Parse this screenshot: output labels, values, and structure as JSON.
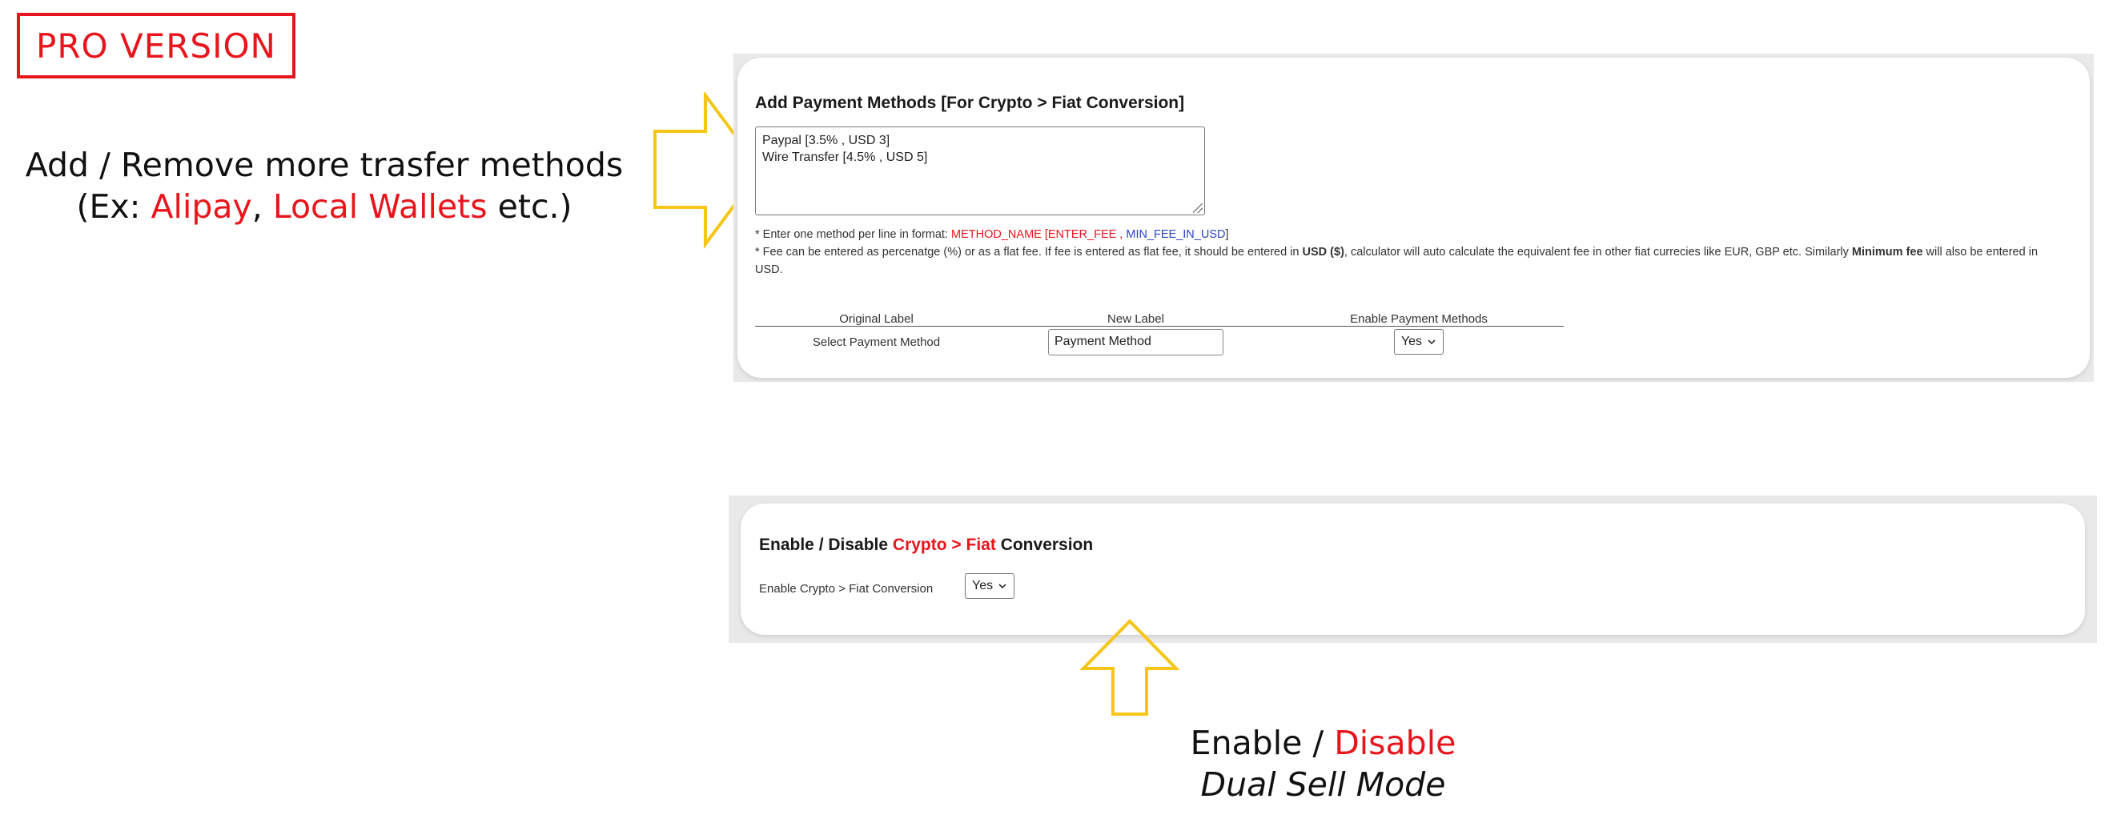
{
  "badge": {
    "label": "PRO VERSION"
  },
  "note_left": {
    "line1": "Add / Remove more trasfer methods",
    "line2_open": "(Ex: ",
    "line2_alipay": "Alipay",
    "line2_comma": ", ",
    "line2_local": "Local Wallets",
    "line2_close": " etc.)"
  },
  "payment_panel": {
    "title": "Add Payment Methods [For Crypto > Fiat Conversion]",
    "methods": [
      "Paypal [3.5% , USD 3]",
      "Wire Transfer [4.5% , USD 5]"
    ],
    "hint1_prefix": "* Enter one method per line in format: ",
    "hint1_method": "METHOD_NAME [ENTER_FEE ,",
    "hint1_min": "MIN_FEE_IN_USD",
    "hint1_close": "]",
    "hint2_a": "* Fee can be entered as percenatge (%) or as a flat fee. If fee is entered as flat fee, it should be entered in ",
    "hint2_usd": "USD ($)",
    "hint2_b": ", calculator will auto calculate the equivalent fee in other fiat currecies like EUR, GBP etc. Similarly ",
    "hint2_min": "Minimum fee",
    "hint2_c": " will also be entered in USD.",
    "table": {
      "headers": [
        "Original Label",
        "New Label",
        "Enable Payment Methods"
      ],
      "row": {
        "original": "Select Payment Method",
        "new_label_value": "Payment Method",
        "enable_value": "Yes"
      }
    }
  },
  "conversion_panel": {
    "title_a": "Enable / Disable ",
    "title_crypto": "Crypto",
    "title_sep": " > ",
    "title_fiat": "Fiat",
    "title_b": " Conversion",
    "row_label": "Enable Crypto > Fiat Conversion",
    "select_value": "Yes"
  },
  "note_bottom": {
    "enable": "Enable",
    "slash": " / ",
    "disable": "Disable",
    "line2": "Dual Sell Mode"
  },
  "colors": {
    "accent_red": "#e8151c",
    "accent_blue": "#2a45c9",
    "arrow_yellow": "#f5c518"
  },
  "icons": [
    "chevron-down-icon",
    "arrow-right-icon",
    "arrow-up-icon"
  ]
}
